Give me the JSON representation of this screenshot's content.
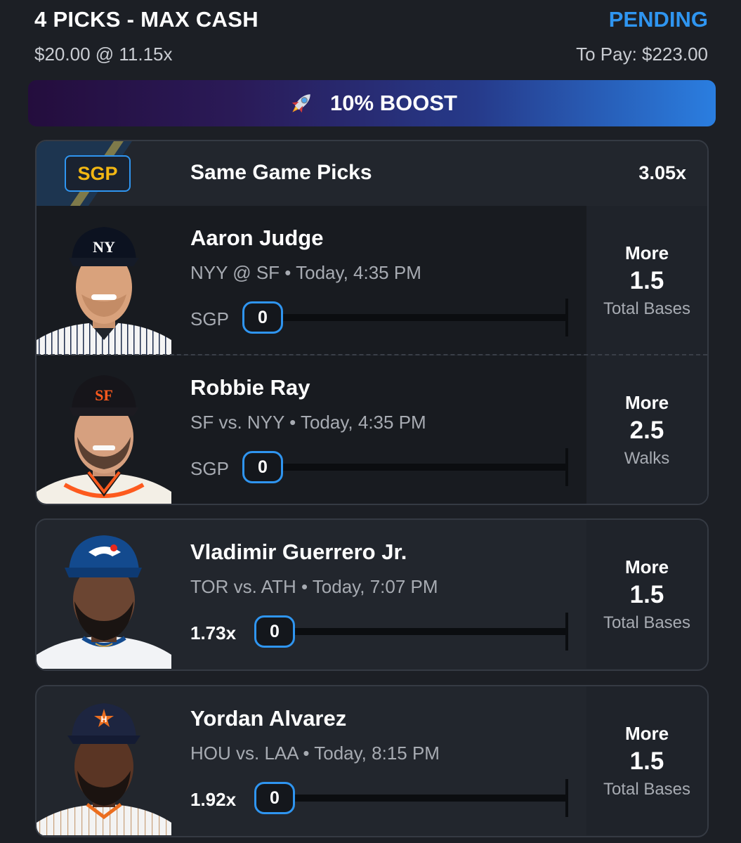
{
  "header": {
    "title": "4 PICKS - MAX CASH",
    "status": "PENDING",
    "wager": "$20.00 @ 11.15x",
    "to_pay": "To Pay: $223.00"
  },
  "boost": {
    "label": "10% BOOST",
    "icon": "rocket-icon"
  },
  "sgp": {
    "badge": "SGP",
    "title": "Same Game Picks",
    "multiplier": "3.05x",
    "picks": [
      {
        "name": "Aaron Judge",
        "game": "NYY @ SF • Today, 4:35 PM",
        "row_label": "SGP",
        "progress": "0",
        "direction": "More",
        "line": "1.5",
        "stat": "Total Bases",
        "team_color": "#0c2340"
      },
      {
        "name": "Robbie Ray",
        "game": "SF vs. NYY • Today, 4:35 PM",
        "row_label": "SGP",
        "progress": "0",
        "direction": "More",
        "line": "2.5",
        "stat": "Walks",
        "team_color": "#fd5a1e"
      }
    ]
  },
  "picks": [
    {
      "name": "Vladimir Guerrero Jr.",
      "game": "TOR vs. ATH • Today, 7:07 PM",
      "row_label": "1.73x",
      "progress": "0",
      "direction": "More",
      "line": "1.5",
      "stat": "Total Bases",
      "team_color": "#134a8e"
    },
    {
      "name": "Yordan Alvarez",
      "game": "HOU vs. LAA • Today, 8:15 PM",
      "row_label": "1.92x",
      "progress": "0",
      "direction": "More",
      "line": "1.5",
      "stat": "Total Bases",
      "team_color": "#eb6e1f"
    }
  ],
  "colors": {
    "accent": "#2f95f0",
    "sgp_gold": "#f2b713",
    "background": "#1c1f25"
  }
}
